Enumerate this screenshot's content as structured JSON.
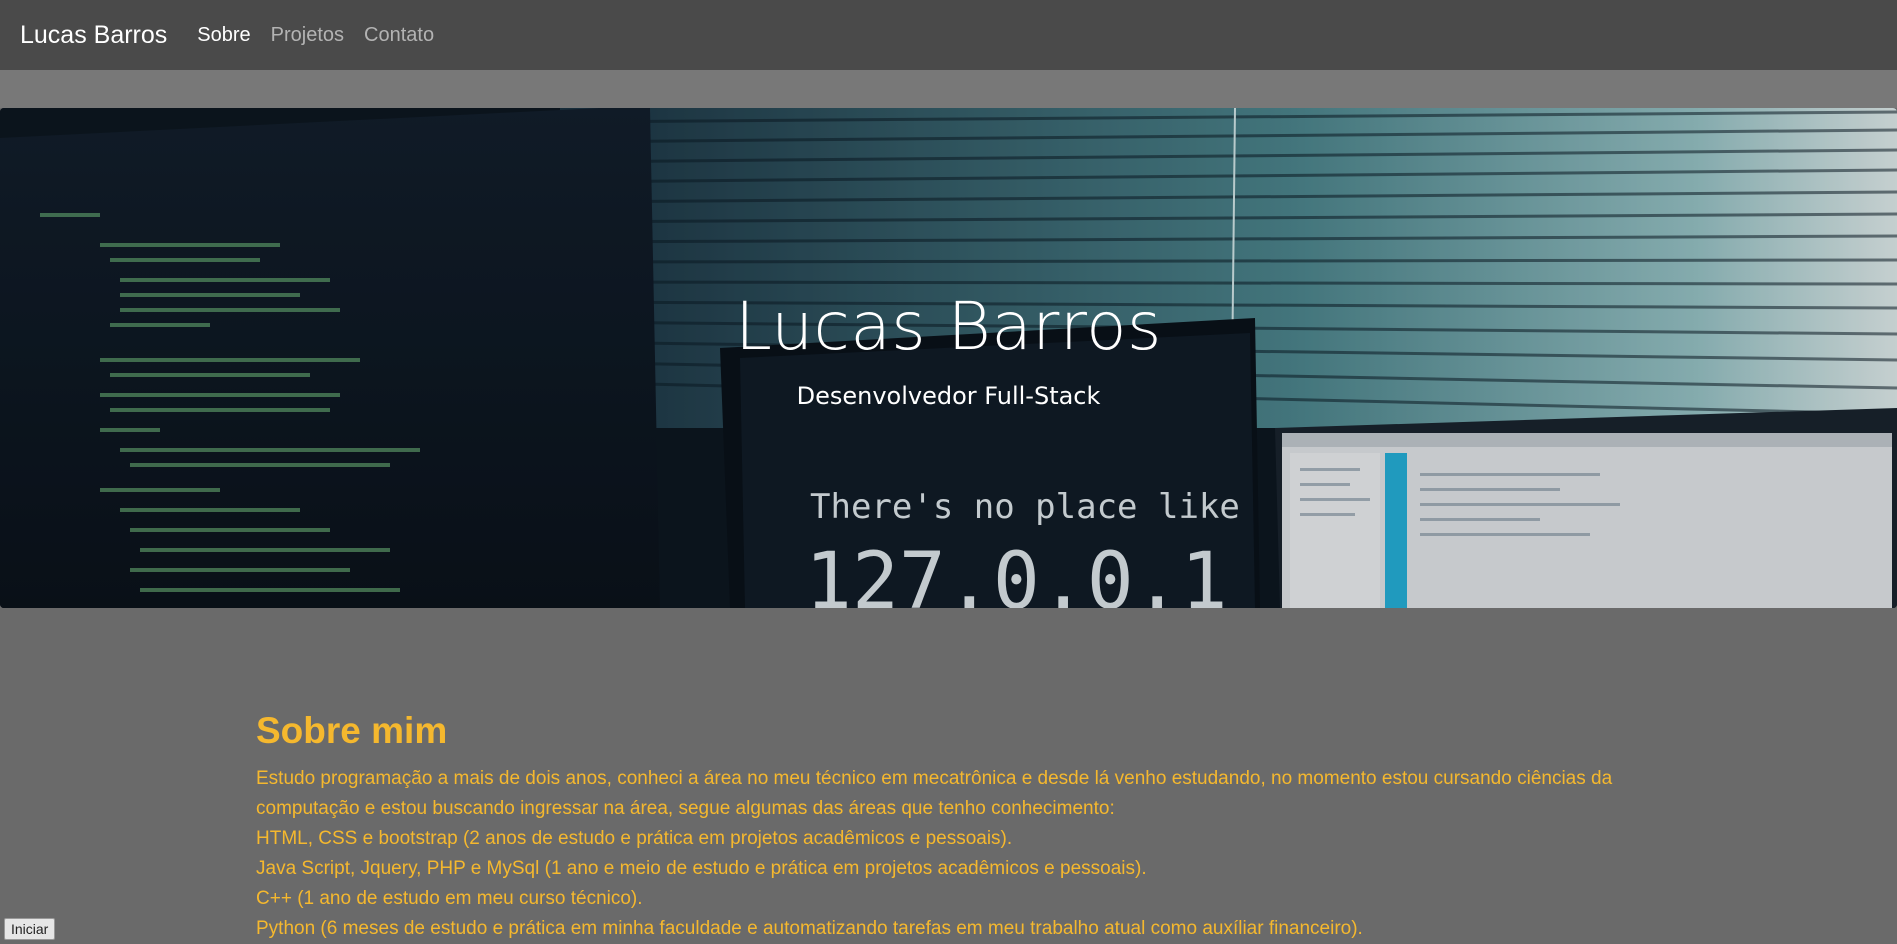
{
  "navbar": {
    "brand": "Lucas Barros",
    "links": [
      {
        "label": "Sobre",
        "active": true
      },
      {
        "label": "Projetos",
        "active": false
      },
      {
        "label": "Contato",
        "active": false
      }
    ]
  },
  "hero": {
    "title": "Lucas Barros",
    "subtitle": "Desenvolvedor Full-Stack",
    "screen_text_line1": "There's no place like",
    "screen_text_line2": "127.0.0.1"
  },
  "about": {
    "heading": "Sobre mim",
    "intro": "Estudo programação a mais de dois anos, conheci a área no meu técnico em mecatrônica e desde lá venho estudando, no momento estou cursando ciências da computação e estou buscando ingressar na área, segue algumas das áreas que tenho conhecimento:",
    "skills": [
      "HTML, CSS e bootstrap (2 anos de estudo e prática em projetos acadêmicos e pessoais).",
      "Java Script, Jquery, PHP e MySql (1 ano e meio de estudo e prática em projetos acadêmicos e pessoais).",
      "C++ (1 ano de estudo em meu curso técnico).",
      "Python (6 meses de estudo e prática em minha faculdade e automatizando tarefas em meu trabalho atual como auxíliar financeiro)."
    ]
  },
  "start_button": "Iniciar",
  "colors": {
    "navbar_bg": "#4a4a4a",
    "page_bg": "#6a6a6a",
    "accent_text": "#f5b82e"
  }
}
